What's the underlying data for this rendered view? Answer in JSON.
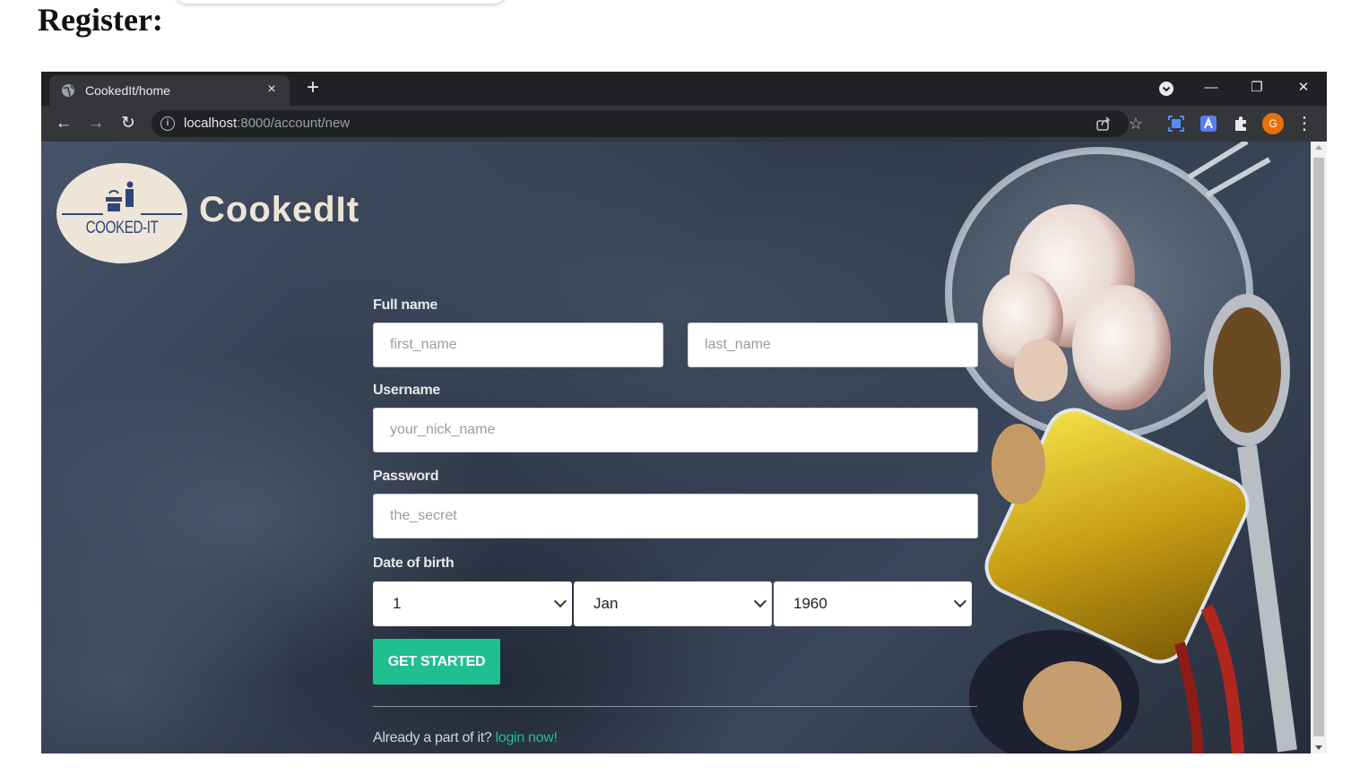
{
  "document": {
    "heading": "Register:"
  },
  "browser": {
    "tab": {
      "title": "CookedIt/home",
      "close": "×",
      "favicon": "globe-icon"
    },
    "new_tab": "+",
    "window_controls": {
      "menu": "chevron-down-circle-icon",
      "minimize": "—",
      "restore": "❐",
      "close": "✕"
    },
    "nav": {
      "back": "←",
      "forward": "→",
      "reload": "↻"
    },
    "address": {
      "host": "localhost",
      "path": ":8000/account/new",
      "info_icon": "i"
    },
    "toolbar_icons": {
      "share": "share-icon",
      "bookmark": "☆",
      "puzzle": "puzzle-icon",
      "menu": "⋮"
    },
    "profile": {
      "initial": "G"
    }
  },
  "page": {
    "logo": {
      "text": "COOKED-IT"
    },
    "brand": "CookedIt",
    "form": {
      "full_name_label": "Full name",
      "first_name_placeholder": "first_name",
      "last_name_placeholder": "last_name",
      "username_label": "Username",
      "username_placeholder": "your_nick_name",
      "password_label": "Password",
      "password_placeholder": "the_secret",
      "dob_label": "Date of birth",
      "dob_day": "1",
      "dob_month": "Jan",
      "dob_year": "1960",
      "submit": "GET STARTED"
    },
    "footer": {
      "text": "Already a part of it?",
      "link": "login now!"
    }
  },
  "colors": {
    "accent": "#1fbf8f",
    "brand_text": "#ece5d7",
    "logo_navy": "#32457a",
    "browser_dark": "#202124"
  }
}
